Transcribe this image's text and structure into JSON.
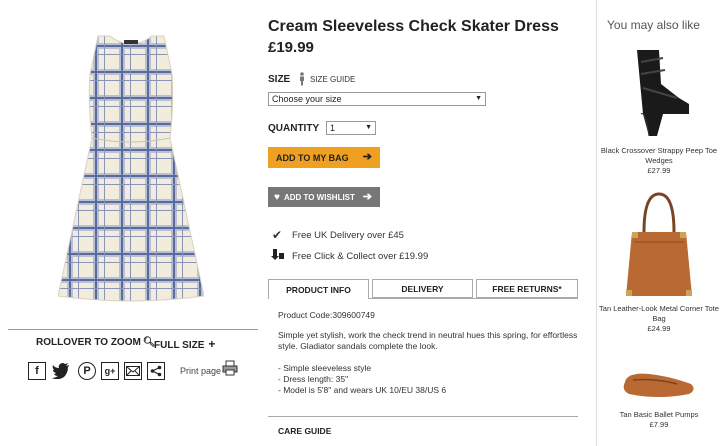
{
  "product": {
    "title": "Cream Sleeveless Check Skater Dress",
    "price": "£19.99",
    "size_label": "SIZE",
    "size_guide": "SIZE GUIDE",
    "size_placeholder": "Choose your size",
    "quantity_label": "QUANTITY",
    "quantity_value": "1",
    "add_to_bag": "ADD TO MY BAG",
    "add_to_wishlist": "ADD TO WISHLIST",
    "perks": [
      {
        "icon": "checkmark-icon",
        "text": "Free UK Delivery over £45"
      },
      {
        "icon": "click-collect-icon",
        "text": "Free Click & Collect over £19.99"
      }
    ]
  },
  "gallery": {
    "zoom_label": "ROLLOVER TO ZOOM",
    "fullsize_label": "FULL SIZE",
    "print_label": "Print page",
    "share_icons": [
      "facebook-icon",
      "twitter-icon",
      "pinterest-icon",
      "google-plus-icon",
      "email-icon",
      "share-icon"
    ]
  },
  "tabs": [
    {
      "label": "PRODUCT INFO",
      "active": true
    },
    {
      "label": "DELIVERY",
      "active": false
    },
    {
      "label": "FREE RETURNS*",
      "active": false
    }
  ],
  "info": {
    "code": "Product Code:309600749",
    "description": "Simple yet stylish, work the check trend in neutral hues this spring, for effortless style. Gladiator sandals complete the look.",
    "bullets": [
      "- Simple sleeveless style",
      "- Dress length: 35\"",
      "- Model is 5'8\" and wears UK 10/EU 38/US 6"
    ],
    "care_guide": "CARE GUIDE"
  },
  "recommendations": {
    "title": "You may also like",
    "items": [
      {
        "name": "Black Crossover Strappy Peep Toe Wedges",
        "price": "£27.99"
      },
      {
        "name": "Tan Leather-Look Metal Corner Tote Bag",
        "price": "£24.99"
      },
      {
        "name": "Tan Basic Ballet Pumps",
        "price": "£7.99"
      }
    ]
  },
  "colors": {
    "accent_orange": "#f0a020",
    "wishlist_grey": "#777777",
    "dress_check_blue": "#5a6a9a",
    "dress_cream": "#f2ecdc",
    "tan": "#b86a32"
  }
}
